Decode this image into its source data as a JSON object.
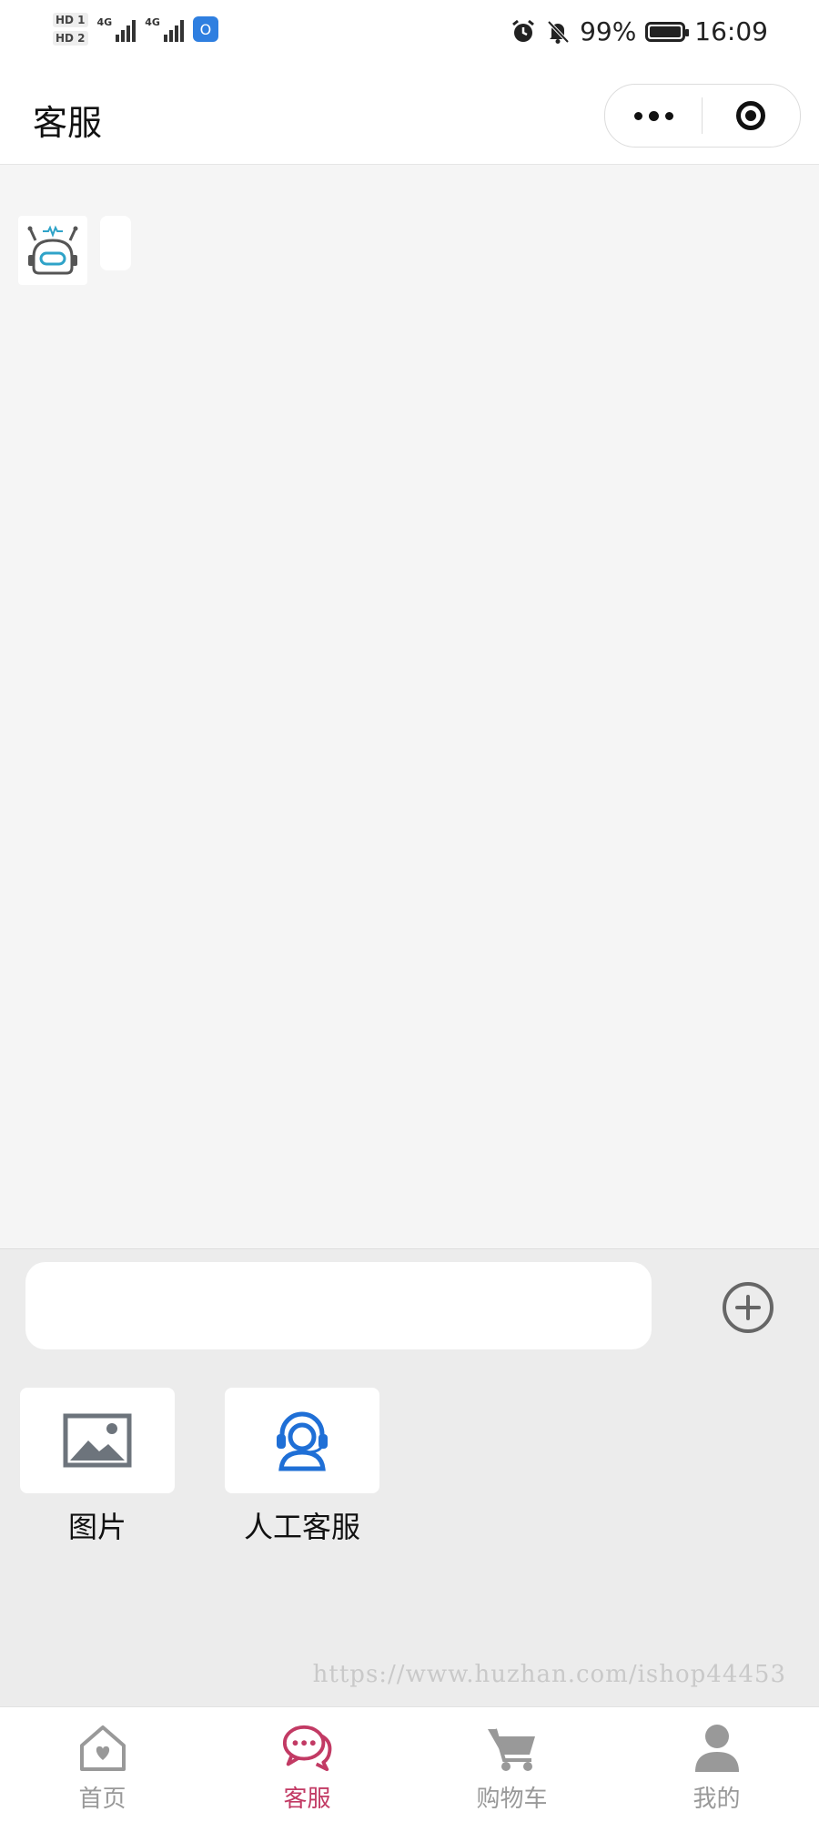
{
  "status_bar": {
    "hd1": "HD 1",
    "hd2": "HD 2",
    "net1": "4G",
    "net2": "4G",
    "battery_percent": "99%",
    "battery_level": 0.99,
    "time": "16:09"
  },
  "header": {
    "title": "客服"
  },
  "chat": {
    "messages": [
      {
        "sender": "bot",
        "text": ""
      }
    ]
  },
  "input": {
    "value": "",
    "placeholder": ""
  },
  "tools": [
    {
      "label": "图片",
      "icon": "image-icon"
    },
    {
      "label": "人工客服",
      "icon": "headset-agent-icon"
    }
  ],
  "watermark": "https://www.huzhan.com/ishop44453",
  "tabbar": {
    "items": [
      {
        "label": "首页",
        "icon": "home-icon",
        "active": false
      },
      {
        "label": "客服",
        "icon": "chat-icon",
        "active": true
      },
      {
        "label": "购物车",
        "icon": "cart-icon",
        "active": false
      },
      {
        "label": "我的",
        "icon": "user-icon",
        "active": false
      }
    ]
  },
  "colors": {
    "accent": "#c23a64",
    "inactive": "#999999",
    "agent_icon": "#1f6fd6",
    "image_icon": "#6d747c"
  }
}
